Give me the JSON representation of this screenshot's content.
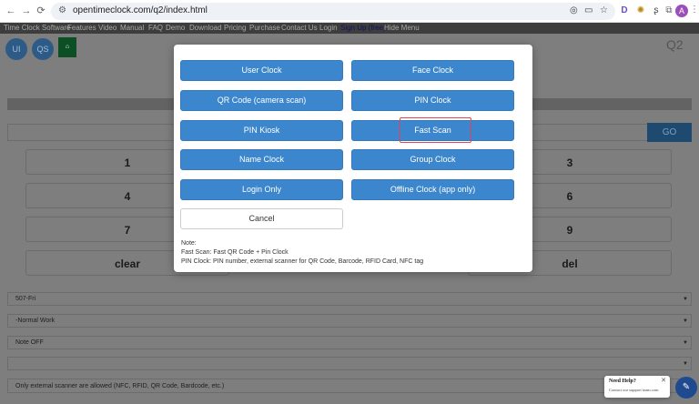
{
  "browser": {
    "url": "opentimeclock.com/q2/index.html",
    "back": "←",
    "forward": "→",
    "reload": "C",
    "profile_initial": "A",
    "ext_d": "D"
  },
  "nav": {
    "items": [
      "Time Clock Software",
      "Features",
      "Video",
      "Manual",
      "FAQ",
      "Demo",
      "Download",
      "Pricing",
      "Purchase",
      "Contact Us",
      "Login",
      "Sign Up (free)",
      "Hide Menu"
    ]
  },
  "page": {
    "circle_ui": "UI",
    "circle_qs": "QS",
    "q2_label": "Q2",
    "go_label": "GO",
    "keypad": {
      "k1": "1",
      "k3": "3",
      "k4": "4",
      "k6": "6",
      "k7": "7",
      "k9": "9",
      "clear": "clear",
      "del": "del"
    },
    "select_day": "507-Fri",
    "select_work": "-Normal Work",
    "select_note": "Note OFF",
    "select_empty": "",
    "scanner_note": "Only external scanner are allowed (NFC, RFID, QR Code, Bardcode, etc.)"
  },
  "modal": {
    "user_clock": "User Clock",
    "face_clock": "Face Clock",
    "qr_code": "QR Code (camera scan)",
    "pin_clock": "PIN Clock",
    "pin_kiosk": "PIN Kiosk",
    "fast_scan": "Fast Scan",
    "name_clock": "Name Clock",
    "group_clock": "Group Clock",
    "login_only": "Login Only",
    "offline_clock": "Offline Clock (app only)",
    "cancel": "Cancel",
    "note_title": "Note:",
    "note_line1": "Fast Scan: Fast QR Code + Pin Clock",
    "note_line2": "PIN Clock: PIN number, external scanner for QR Code, Barcode, RFID Card, NFC tag"
  },
  "help": {
    "title": "Need Help?",
    "subtitle": "Contact our support team.com",
    "close": "✕"
  },
  "colors": {
    "button_blue": "#3b86cc",
    "highlight": "#e0435a",
    "overlay": "#7e7e7e"
  }
}
